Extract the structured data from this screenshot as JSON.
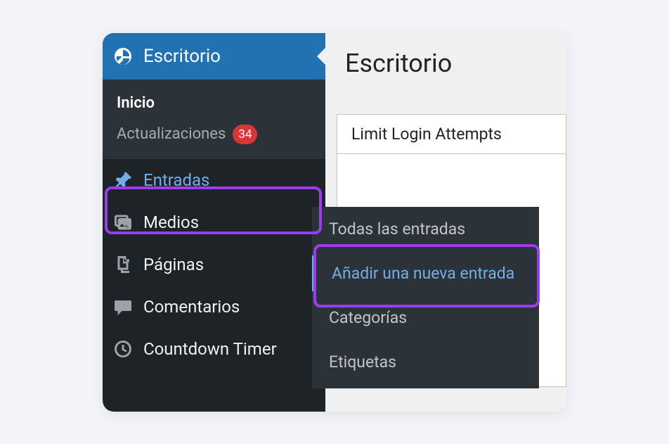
{
  "sidebar": {
    "top": {
      "label": "Escritorio"
    },
    "sub": {
      "home": "Inicio",
      "updates": "Actualizaciones",
      "updates_count": "34"
    },
    "items": [
      {
        "label": "Entradas"
      },
      {
        "label": "Medios"
      },
      {
        "label": "Páginas"
      },
      {
        "label": "Comentarios"
      },
      {
        "label": "Countdown Timer"
      }
    ]
  },
  "content": {
    "heading": "Escritorio",
    "card_title": "Limit Login Attempts"
  },
  "flyout": {
    "all": "Todas las entradas",
    "add": "Añadir una nueva entrada",
    "categories": "Categorías",
    "tags": "Etiquetas"
  }
}
